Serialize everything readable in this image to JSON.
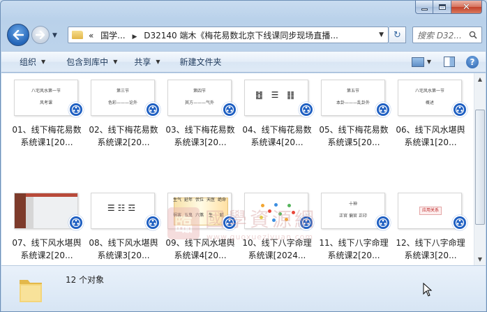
{
  "window": {
    "minimize_label": "",
    "maximize_label": "",
    "close_label": "✕"
  },
  "address_bar": {
    "chevron": "«",
    "crumb_1": "国学...",
    "crumb_2": "D32140 端木《梅花易数北京下线课同步现场直播..."
  },
  "search": {
    "placeholder": "搜索 D32..."
  },
  "toolbar": {
    "organize": "组织",
    "include_library": "包含到库中",
    "share": "共享",
    "new_folder": "新建文件夹"
  },
  "files": [
    {
      "label": "01、线下梅花易数系统课1[20...",
      "thumb": {
        "kind": "doc",
        "title": "八宅风水第一节",
        "sub": "风考课"
      }
    },
    {
      "label": "02、线下梅花易数系统课2[20...",
      "thumb": {
        "kind": "doc",
        "title": "第三节",
        "sub": "色彩———论外"
      }
    },
    {
      "label": "03、线下梅花易数系统课3[20...",
      "thumb": {
        "kind": "doc",
        "title": "第四节",
        "sub": "其方———气外"
      }
    },
    {
      "label": "04、线下梅花易数系统课4[20...",
      "thumb": {
        "kind": "hexagram",
        "title": "䷂ ☰ ䷁"
      }
    },
    {
      "label": "05、线下梅花易数系统课5[20...",
      "thumb": {
        "kind": "doc",
        "title": "第五节",
        "sub": "本卦———乱卦外"
      }
    },
    {
      "label": "06、线下风水堪舆系统课1[20...",
      "thumb": {
        "kind": "doc",
        "title": "八宅风水第一节",
        "sub": "概述"
      }
    },
    {
      "label": "07、线下风水堪舆系统课2[20...",
      "thumb": {
        "kind": "photo"
      }
    },
    {
      "label": "08、线下风水堪舆系统课3[20...",
      "thumb": {
        "kind": "hexagram",
        "title": "☰☷☲"
      }
    },
    {
      "label": "09、线下风水堪舆系统课4[20...",
      "thumb": {
        "kind": "cells",
        "cells": [
          "生气",
          "延年",
          "伏位",
          "天医",
          "绝命",
          "祸害",
          "五鬼",
          "六煞",
          "生",
          "延"
        ]
      }
    },
    {
      "label": "10、线下八字命理系统课[2024...",
      "thumb": {
        "kind": "dots"
      }
    },
    {
      "label": "11、线下八字命理系统课2[20...",
      "thumb": {
        "kind": "doc",
        "title": "十神",
        "sub": "正官 偏官 正印"
      }
    },
    {
      "label": "12、线下八字命理系统课3[20...",
      "thumb": {
        "kind": "box",
        "title": "应用关系"
      }
    }
  ],
  "watermark": {
    "seal": "臨",
    "title": "國學資源網",
    "url": "www.guoxueziyuan.com"
  },
  "status": {
    "count_text": "12 个对象"
  },
  "colors": {
    "badge": "#1e5fc2",
    "toolbar_text": "#1e395b"
  }
}
